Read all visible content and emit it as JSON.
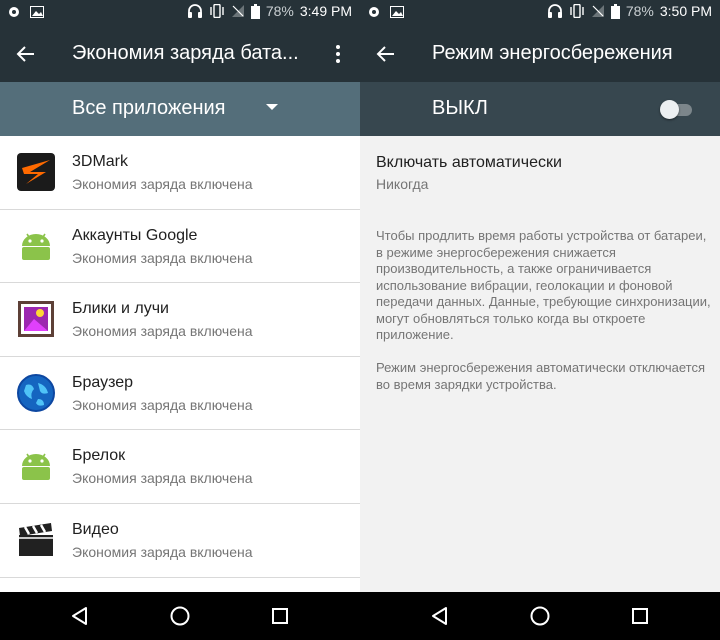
{
  "left": {
    "status_bar": {
      "battery_percent": "78%",
      "time": "3:49 PM"
    },
    "toolbar": {
      "title": "Экономия заряда бата..."
    },
    "filter": {
      "label": "Все приложения"
    },
    "apps": [
      {
        "name": "3DMark",
        "status": "Экономия заряда включена",
        "icon": "3dmark-icon"
      },
      {
        "name": "Аккаунты Google",
        "status": "Экономия заряда включена",
        "icon": "android-icon"
      },
      {
        "name": "Блики и лучи",
        "status": "Экономия заряда включена",
        "icon": "photo-frame-icon"
      },
      {
        "name": "Браузер",
        "status": "Экономия заряда включена",
        "icon": "globe-icon"
      },
      {
        "name": "Брелок",
        "status": "Экономия заряда включена",
        "icon": "android-icon"
      },
      {
        "name": "Видео",
        "status": "Экономия заряда включена",
        "icon": "clapperboard-icon"
      }
    ]
  },
  "right": {
    "status_bar": {
      "battery_percent": "78%",
      "time": "3:50 PM"
    },
    "toolbar": {
      "title": "Режим энергосбережения"
    },
    "switch": {
      "label": "ВЫКЛ",
      "on": false
    },
    "auto": {
      "title": "Включать автоматически",
      "summary": "Никогда"
    },
    "description_1": "Чтобы продлить время работы устройства от батареи, в режиме энергосбережения снижается производительность, а также ограничивается использование вибрации, геолокации и фоновой передачи данных. Данные, требующие синхронизации, могут обновляться только когда вы откроете приложение.",
    "description_2": "Режим энергосбережения автоматически отключается во время зарядки устройства."
  },
  "colors": {
    "toolbar": "#263238",
    "filter_bar": "#546e7a",
    "switch_bar": "#37474f",
    "android_green": "#8bc34a"
  }
}
